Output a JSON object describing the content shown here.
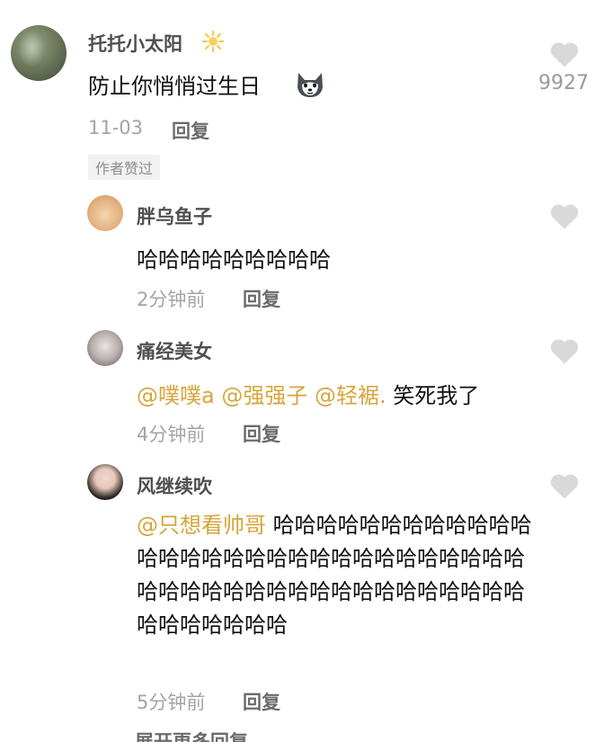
{
  "comments": {
    "main": {
      "username": "托托小太阳",
      "text": "防止你悄悄过生日",
      "likes": "9927",
      "date": "11-03",
      "reply_label": "回复",
      "badge": "作者赞过",
      "name_icon": "sun-icon",
      "emoji": "husky-dog-emoji"
    },
    "replies": [
      {
        "username": "胖乌鱼子",
        "text": "哈哈哈哈哈哈哈哈哈",
        "time": "2分钟前",
        "reply_label": "回复"
      },
      {
        "username": "痛经美女",
        "mentions": "@噗噗a @强强子 @轻裾.",
        "text": "笑死我了",
        "time": "4分钟前",
        "reply_label": "回复"
      },
      {
        "username": "风继续吹",
        "mention": "@只想看帅哥",
        "text": "哈哈哈哈哈哈哈哈哈哈哈哈哈哈哈哈哈哈哈哈哈哈哈哈哈哈哈哈哈哈哈哈哈哈哈哈哈哈哈哈哈哈哈哈哈哈哈哈哈哈哈哈哈哈哈",
        "time": "5分钟前",
        "reply_label": "回复"
      }
    ],
    "next_partial_text": "展开更多回复"
  },
  "colors": {
    "mention": "#d6a53a",
    "heart": "#d9d9d9",
    "username": "#4f4f4f",
    "meta": "#a4a4a4"
  }
}
